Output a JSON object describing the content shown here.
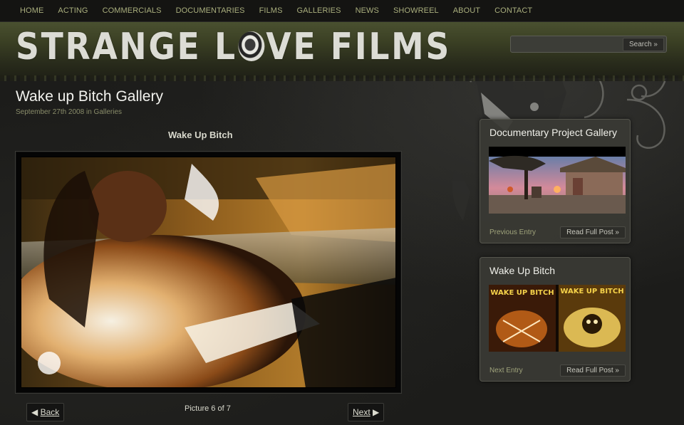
{
  "nav": {
    "items": [
      {
        "label": "HOME"
      },
      {
        "label": "ACTING"
      },
      {
        "label": "COMMERCIALS"
      },
      {
        "label": "DOCUMENTARIES"
      },
      {
        "label": "FILMS"
      },
      {
        "label": "GALLERIES"
      },
      {
        "label": "NEWS"
      },
      {
        "label": "SHOWREEL"
      },
      {
        "label": "ABOUT"
      },
      {
        "label": "CONTACT"
      }
    ]
  },
  "header": {
    "logo_part1": "STRANGE L",
    "logo_part2": "VE FILMS"
  },
  "search": {
    "value": "",
    "button_label": "Search »"
  },
  "post": {
    "title": "Wake up Bitch Gallery",
    "date": "September 27th 2008",
    "meta_in": "in",
    "category": "Galleries",
    "image_caption": "Wake Up Bitch"
  },
  "pager": {
    "back_arrow": "◀",
    "back_label": "Back",
    "next_label": "Next",
    "next_arrow": "▶",
    "status": "Picture 6 of 7"
  },
  "sidebar": {
    "prev_card": {
      "title": "Documentary Project Gallery",
      "footer_label": "Previous Entry",
      "read_more": "Read Full Post »"
    },
    "next_card": {
      "title": "Wake Up Bitch",
      "thumb_text_left": "WAKE UP BITCH",
      "thumb_text_right": "WAKE UP BITCH",
      "footer_label": "Next Entry",
      "read_more": "Read Full Post »"
    }
  },
  "colors": {
    "nav_text": "#a9ae7d",
    "header_olive": "#4a5130",
    "meta_text": "#8a8d6a",
    "thumb_text": "#f5d24a"
  }
}
